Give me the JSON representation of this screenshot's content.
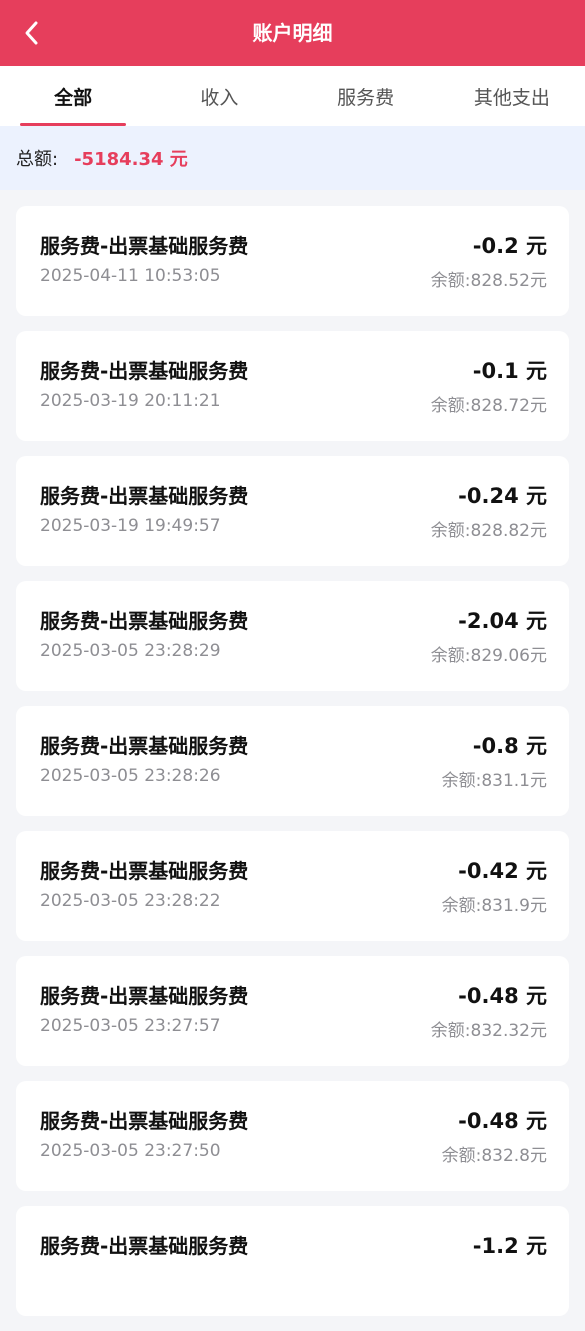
{
  "header": {
    "title": "账户明细",
    "back_icon": "chevron-left-icon"
  },
  "tabs": [
    {
      "label": "全部",
      "active": true
    },
    {
      "label": "收入",
      "active": false
    },
    {
      "label": "服务费",
      "active": false
    },
    {
      "label": "其他支出",
      "active": false
    }
  ],
  "summary": {
    "label": "总额:",
    "value": "-5184.34 元"
  },
  "colors": {
    "brand": "#e63e5c",
    "summary_bg": "#ecf2fe",
    "page_bg": "#f4f5f8"
  },
  "records": [
    {
      "title": "服务费-出票基础服务费",
      "time": "2025-04-11 10:53:05",
      "amount": "-0.2 元",
      "balance": "余额:828.52元"
    },
    {
      "title": "服务费-出票基础服务费",
      "time": "2025-03-19 20:11:21",
      "amount": "-0.1 元",
      "balance": "余额:828.72元"
    },
    {
      "title": "服务费-出票基础服务费",
      "time": "2025-03-19 19:49:57",
      "amount": "-0.24 元",
      "balance": "余额:828.82元"
    },
    {
      "title": "服务费-出票基础服务费",
      "time": "2025-03-05 23:28:29",
      "amount": "-2.04 元",
      "balance": "余额:829.06元"
    },
    {
      "title": "服务费-出票基础服务费",
      "time": "2025-03-05 23:28:26",
      "amount": "-0.8 元",
      "balance": "余额:831.1元"
    },
    {
      "title": "服务费-出票基础服务费",
      "time": "2025-03-05 23:28:22",
      "amount": "-0.42 元",
      "balance": "余额:831.9元"
    },
    {
      "title": "服务费-出票基础服务费",
      "time": "2025-03-05 23:27:57",
      "amount": "-0.48 元",
      "balance": "余额:832.32元"
    },
    {
      "title": "服务费-出票基础服务费",
      "time": "2025-03-05 23:27:50",
      "amount": "-0.48 元",
      "balance": "余额:832.8元"
    },
    {
      "title": "服务费-出票基础服务费",
      "time": "",
      "amount": "-1.2 元",
      "balance": ""
    }
  ]
}
